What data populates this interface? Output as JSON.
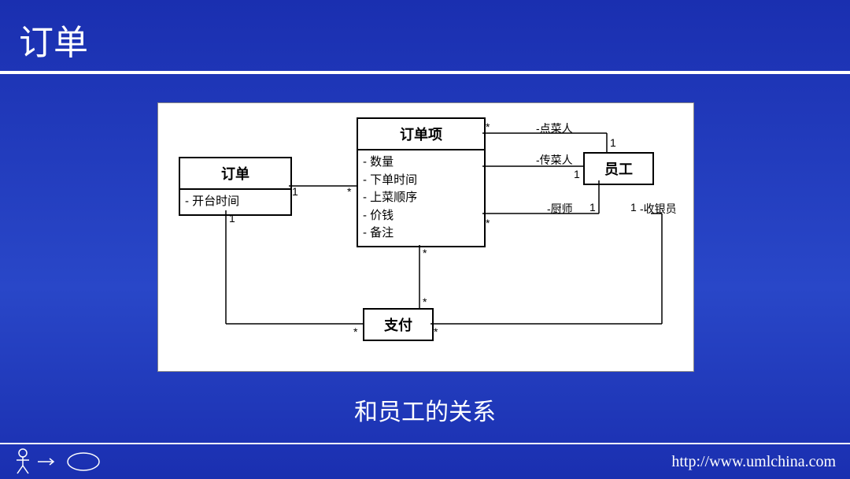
{
  "title": "订单",
  "caption": "和员工的关系",
  "footer_url": "http://www.umlchina.com",
  "classes": {
    "order": {
      "name": "订单",
      "attrs": [
        "开台时间"
      ]
    },
    "item": {
      "name": "订单项",
      "attrs": [
        "数量",
        "下单时间",
        "上菜顺序",
        "价钱",
        "备注"
      ]
    },
    "employee": {
      "name": "员工",
      "attrs": []
    },
    "payment": {
      "name": "支付",
      "attrs": []
    }
  },
  "chart_data": {
    "type": "uml-class-diagram",
    "classes": [
      {
        "id": "order",
        "name": "订单",
        "attributes": [
          "开台时间"
        ]
      },
      {
        "id": "item",
        "name": "订单项",
        "attributes": [
          "数量",
          "下单时间",
          "上菜顺序",
          "价钱",
          "备注"
        ]
      },
      {
        "id": "employee",
        "name": "员工",
        "attributes": []
      },
      {
        "id": "payment",
        "name": "支付",
        "attributes": []
      }
    ],
    "associations": [
      {
        "from": "order",
        "to": "item",
        "from_mult": "1",
        "to_mult": "*"
      },
      {
        "from": "item",
        "to": "employee",
        "role": "-点菜人",
        "from_mult": "*",
        "to_mult": "1"
      },
      {
        "from": "item",
        "to": "employee",
        "role": "-传菜人",
        "from_mult": "",
        "to_mult": "1"
      },
      {
        "from": "item",
        "to": "employee",
        "role": "-厨师",
        "from_mult": "*",
        "to_mult": "1"
      },
      {
        "from": "order",
        "to": "payment",
        "from_mult": "1",
        "to_mult": "*"
      },
      {
        "from": "item",
        "to": "payment",
        "from_mult": "*",
        "to_mult": "*"
      },
      {
        "from": "payment",
        "to": "employee",
        "role": "-收银员",
        "from_mult": "*",
        "to_mult": "1"
      }
    ]
  },
  "mult": {
    "order_item_from": "1",
    "order_item_to": "*",
    "item_emp_top_from": "*",
    "item_emp_top_to": "1",
    "item_emp_top_role": "-点菜人",
    "item_emp_mid_to": "1",
    "item_emp_mid_role": "-传菜人",
    "item_emp_bot_from": "*",
    "item_emp_bot_to": "1",
    "item_emp_bot_role": "-厨师",
    "order_pay_from": "1",
    "order_pay_to": "*",
    "item_pay_from": "*",
    "item_pay_to": "*",
    "pay_emp_from": "*",
    "pay_emp_to": "1",
    "pay_emp_role": "-收银员"
  }
}
